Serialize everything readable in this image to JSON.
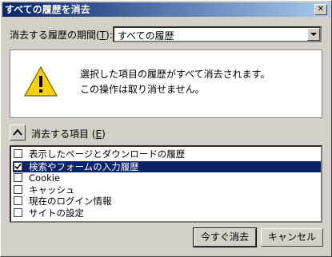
{
  "window": {
    "title": "すべての履歴を消去"
  },
  "period": {
    "label": "消去する履歴の期間(",
    "label_key": "T",
    "label_end": "):",
    "value": "すべての履歴"
  },
  "warning": {
    "line1": "選択した項目の履歴がすべて消去されます。",
    "line2": "この操作は取り消せません。"
  },
  "items_section": {
    "label": "消去する項目 (",
    "label_key": "E",
    "label_end": ")"
  },
  "items": [
    {
      "label": "表示したページとダウンロードの履歴",
      "checked": false,
      "selected": false
    },
    {
      "label": "検索やフォームの入力履歴",
      "checked": true,
      "selected": true
    },
    {
      "label": "Cookie",
      "checked": false,
      "selected": false
    },
    {
      "label": "キャッシュ",
      "checked": false,
      "selected": false
    },
    {
      "label": "現在のログイン情報",
      "checked": false,
      "selected": false
    },
    {
      "label": "サイトの設定",
      "checked": false,
      "selected": false
    }
  ],
  "buttons": {
    "clear_now": "今すぐ消去",
    "cancel": "キャンセル"
  }
}
